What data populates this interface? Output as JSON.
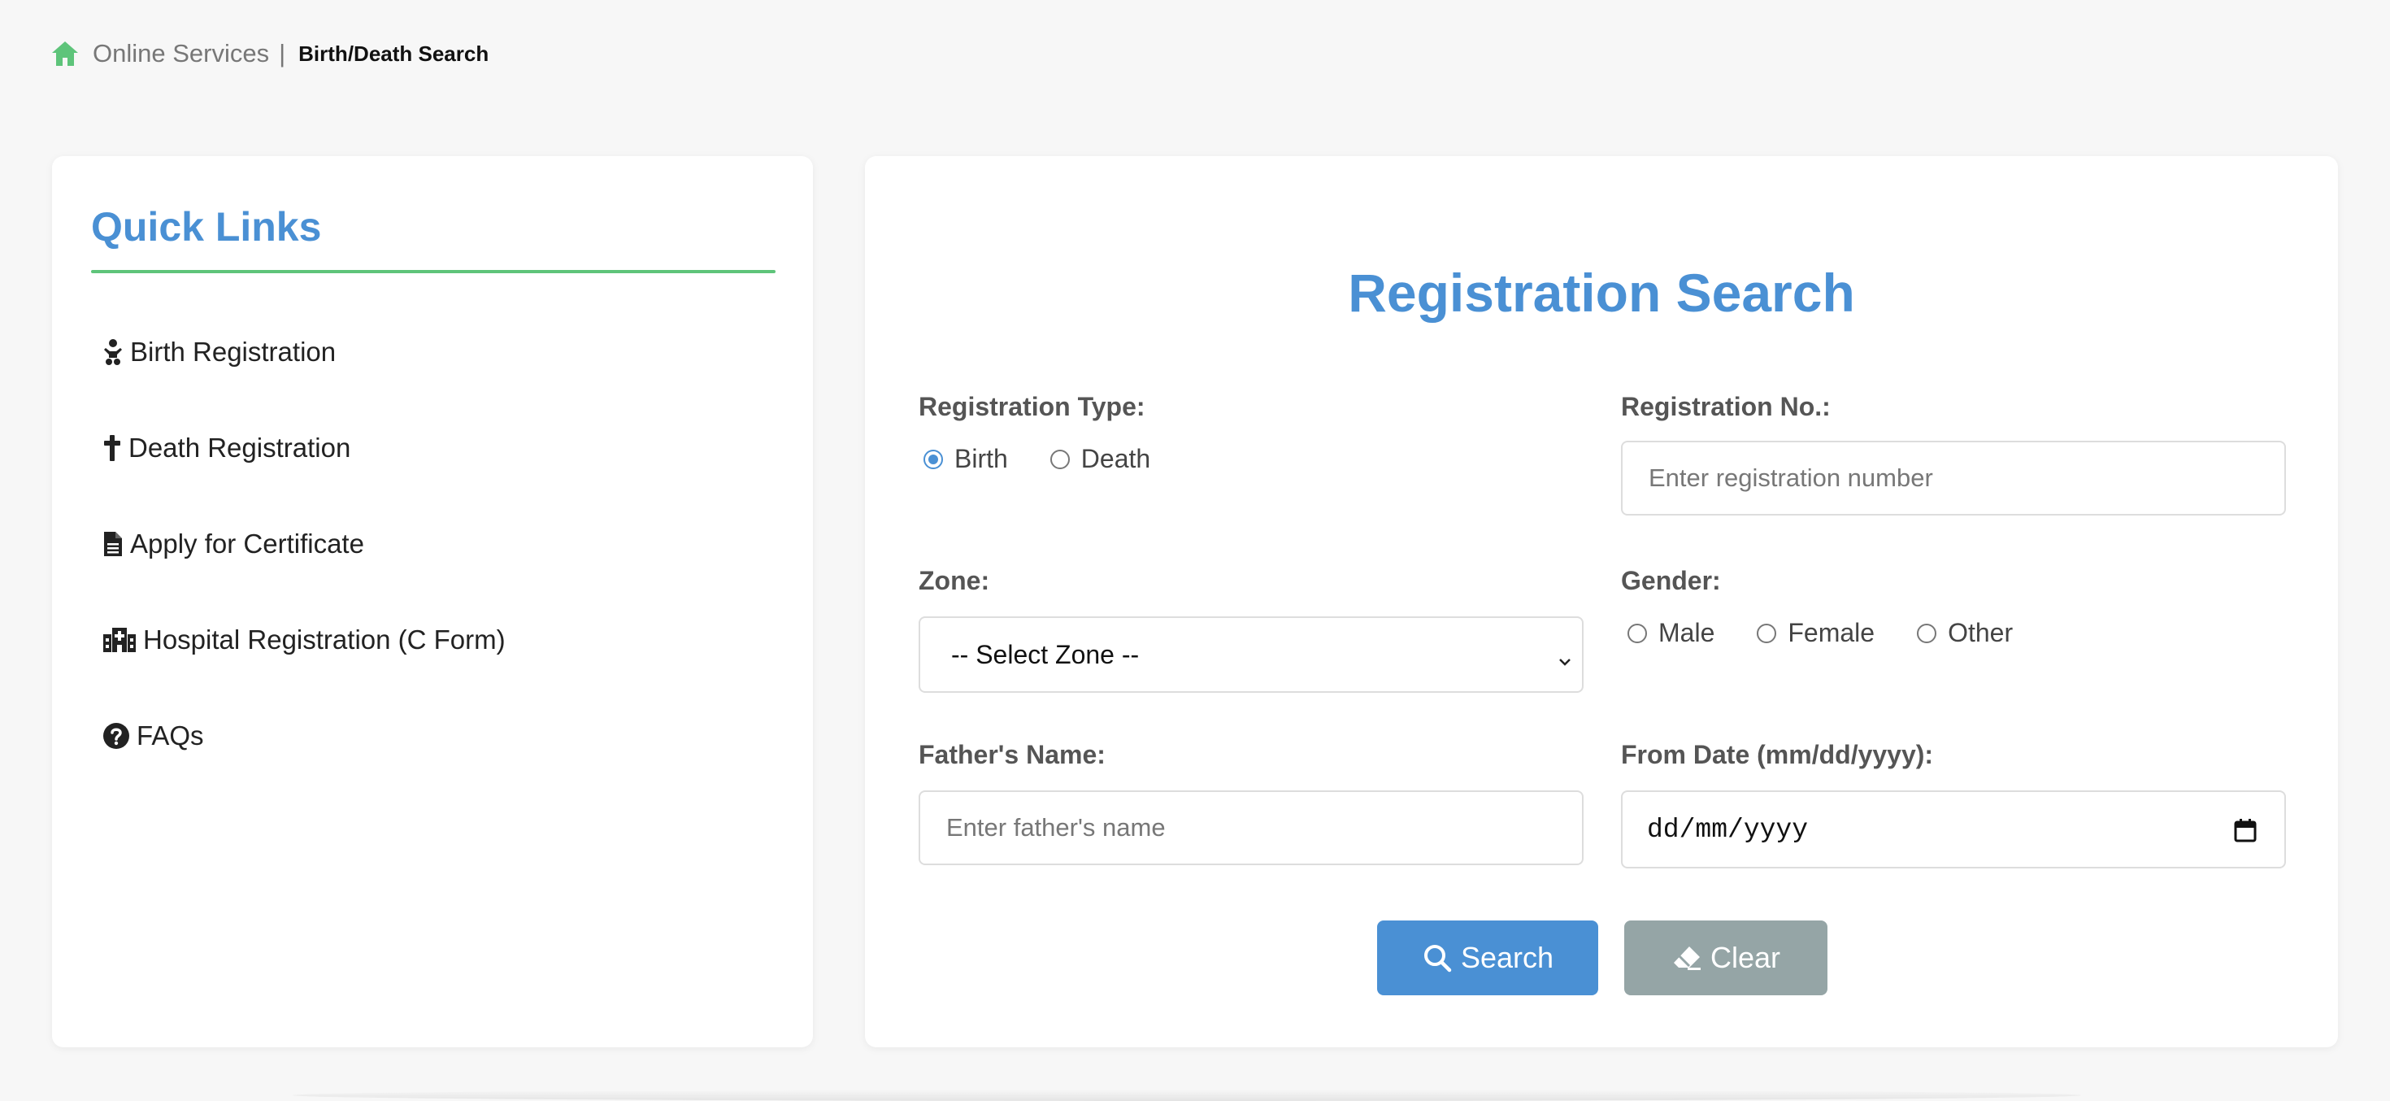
{
  "breadcrumb": {
    "home_icon": "home-icon",
    "link": "Online Services",
    "separator": "|",
    "current": "Birth/Death Search"
  },
  "quick_links": {
    "title": "Quick Links",
    "items": [
      {
        "icon": "baby-icon",
        "label": "Birth Registration"
      },
      {
        "icon": "cross-icon",
        "label": "Death Registration"
      },
      {
        "icon": "file-icon",
        "label": "Apply for Certificate"
      },
      {
        "icon": "hospital-icon",
        "label": "Hospital Registration (C Form)"
      },
      {
        "icon": "question-circle-icon",
        "label": "FAQs"
      }
    ]
  },
  "search": {
    "title": "Registration Search",
    "registration_type": {
      "label": "Registration Type:",
      "options": [
        "Birth",
        "Death"
      ],
      "selected": "Birth"
    },
    "registration_no": {
      "label": "Registration No.:",
      "placeholder": "Enter registration number"
    },
    "zone": {
      "label": "Zone:",
      "selected": "-- Select Zone --"
    },
    "gender": {
      "label": "Gender:",
      "options": [
        "Male",
        "Female",
        "Other"
      ]
    },
    "fathers_name": {
      "label": "Father's Name:",
      "placeholder": "Enter father's name"
    },
    "from_date": {
      "label": "From Date (mm/dd/yyyy):",
      "value": "dd/mm/yyyy"
    },
    "search_button": "Search",
    "clear_button": "Clear"
  },
  "colors": {
    "accent": "#4a90d4",
    "rule_green": "#5ec47a",
    "clear_gray": "#95a5a6"
  }
}
